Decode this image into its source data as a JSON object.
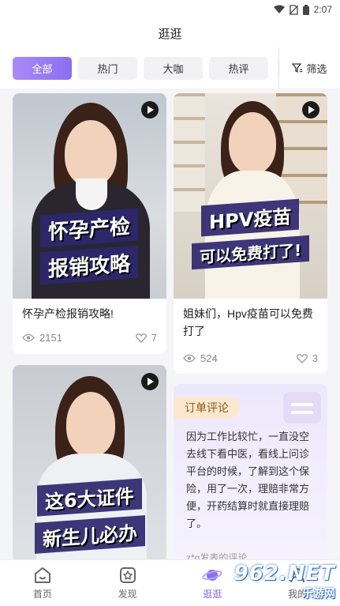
{
  "status_bar": {
    "time": "2:07"
  },
  "header": {
    "title": "逛逛"
  },
  "filters": {
    "chips": [
      "全部",
      "热门",
      "大咖",
      "热评"
    ],
    "filter_label": "筛选"
  },
  "cards": [
    {
      "banner": [
        "怀孕产检",
        "报销攻略"
      ],
      "title": "怀孕产检报销攻略!",
      "views": "2151",
      "likes": "7"
    },
    {
      "banner": [
        "HPV疫苗",
        "可以免费打了!"
      ],
      "title": "姐妹们，Hpv疫苗可以免费打了",
      "views": "524",
      "likes": "3"
    },
    {
      "banner": [
        "这6大证件",
        "新生儿必办"
      ]
    }
  ],
  "review": {
    "tag": "订单评论",
    "text": "因为工作比较忙，一直没空去线下看中医，看线上问诊平台的时候，了解到这个保险，用了一次，理赔非常方便，开药结算时就直接理赔了。",
    "footer": "z*g发表的评论"
  },
  "tabs": [
    "首页",
    "发现",
    "逛逛",
    "我的"
  ],
  "watermark": {
    "main": "962.NET",
    "sub": "乐游网"
  },
  "colors": {
    "accent": "#8a6ef0",
    "tab_active": "#7d62e6",
    "banner_bg": "#2e266e"
  }
}
